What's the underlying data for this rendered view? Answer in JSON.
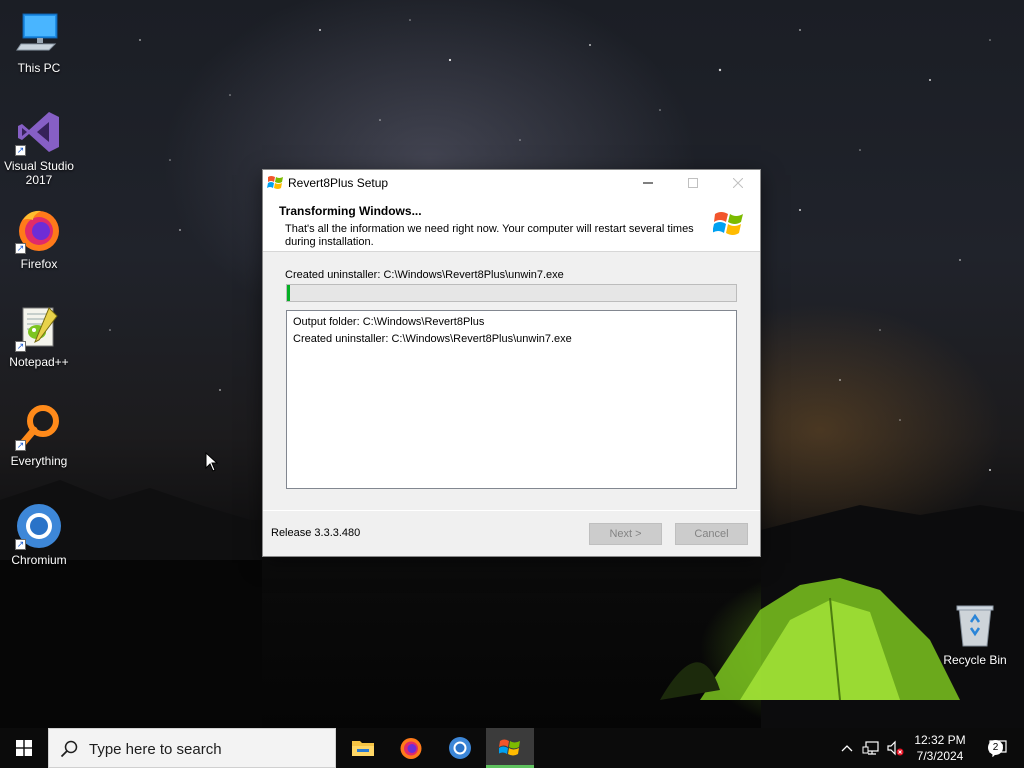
{
  "desktop": {
    "icons": [
      {
        "label": "This PC",
        "icon": "this-pc-icon"
      },
      {
        "label": "Visual Studio 2017",
        "icon": "visual-studio-icon"
      },
      {
        "label": "Firefox",
        "icon": "firefox-icon"
      },
      {
        "label": "Notepad++",
        "icon": "notepadpp-icon"
      },
      {
        "label": "Everything",
        "icon": "everything-icon"
      },
      {
        "label": "Chromium",
        "icon": "chromium-icon"
      },
      {
        "label": "Recycle Bin",
        "icon": "recycle-bin-icon"
      }
    ]
  },
  "window": {
    "title": "Revert8Plus Setup",
    "header_title": "Transforming Windows...",
    "header_subtitle": "That's all the information we need right now. Your computer will restart several times during installation.",
    "status": "Created uninstaller: C:\\Windows\\Revert8Plus\\unwin7.exe",
    "progress_percent": 0.6,
    "log": [
      "Output folder: C:\\Windows\\Revert8Plus",
      "Created uninstaller: C:\\Windows\\Revert8Plus\\unwin7.exe"
    ],
    "release": "Release 3.3.3.480",
    "next_label": "Next >",
    "cancel_label": "Cancel"
  },
  "taskbar": {
    "search_placeholder": "Type here to search",
    "pinned": [
      "file-explorer-icon",
      "firefox-icon",
      "chromium-icon",
      "revert8plus-setup-icon"
    ],
    "active_app": "revert8plus-setup-icon",
    "time": "12:32 PM",
    "date": "7/3/2024",
    "notification_count": "2"
  },
  "colors": {
    "progress_fill": "#06b025",
    "taskbar": "#0b0b0b",
    "active_indicator": "#5ec15e"
  }
}
